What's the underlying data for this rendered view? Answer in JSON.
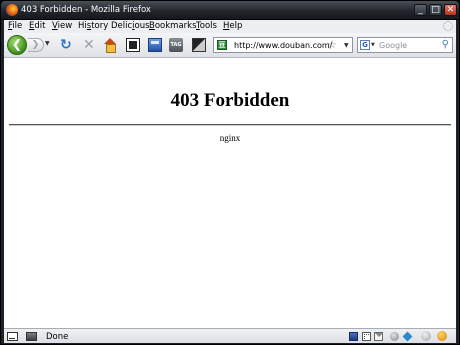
{
  "window": {
    "title": "403 Forbidden - Mozilla Firefox"
  },
  "menu": {
    "items": [
      {
        "label": "File",
        "accel": "F",
        "rest": "ile"
      },
      {
        "label": "Edit",
        "accel": "E",
        "rest": "dit"
      },
      {
        "label": "View",
        "accel": "V",
        "rest": "iew"
      },
      {
        "label": "History",
        "pre": "Hi",
        "accel": "s",
        "rest": "tory"
      },
      {
        "label": "Delicious",
        "pre": "Delic",
        "accel": "i",
        "rest": "ous"
      },
      {
        "label": "Bookmarks",
        "accel": "B",
        "rest": "ookmarks"
      },
      {
        "label": "Tools",
        "accel": "T",
        "rest": "ools"
      },
      {
        "label": "Help",
        "accel": "H",
        "rest": "elp"
      }
    ]
  },
  "toolbar": {
    "back_glyph": "❮",
    "forward_glyph": "❯",
    "dropdown_glyph": "▼",
    "reload_glyph": "↻",
    "stop_glyph": "✕",
    "tag_text": "TAG"
  },
  "urlbar": {
    "site_glyph": "豆",
    "value": "http://www.douban.com/",
    "star_glyph": "☆",
    "dropdown_glyph": "▼"
  },
  "search": {
    "engine_glyph": "G",
    "dropdown_glyph": "▼",
    "placeholder": "Google",
    "go_glyph": "⚲"
  },
  "page": {
    "heading": "403 Forbidden",
    "server": "nginx"
  },
  "status": {
    "text": "Done"
  },
  "colors": {
    "title_bar": "#22262c",
    "chrome": "#edeef0",
    "back_button": "#3e8d1a",
    "reload": "#2e73c8"
  }
}
